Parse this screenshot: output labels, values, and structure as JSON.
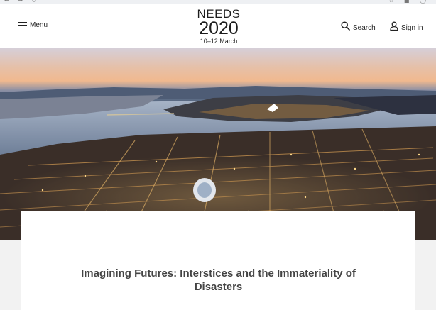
{
  "header": {
    "menu_label": "Menu",
    "logo": {
      "line1": "NEEDS",
      "line2": "2020",
      "line3": "10–12 March"
    },
    "search_label": "Search",
    "signin_label": "Sign in"
  },
  "hero": {
    "alt": "Aerial night view of a snow-covered city by a frozen sea"
  },
  "article": {
    "title": "Imagining Futures: Interstices and the Immateriality of Disasters"
  },
  "icons": {
    "menu": "hamburger-icon",
    "search": "search-icon",
    "signin": "user-icon"
  }
}
